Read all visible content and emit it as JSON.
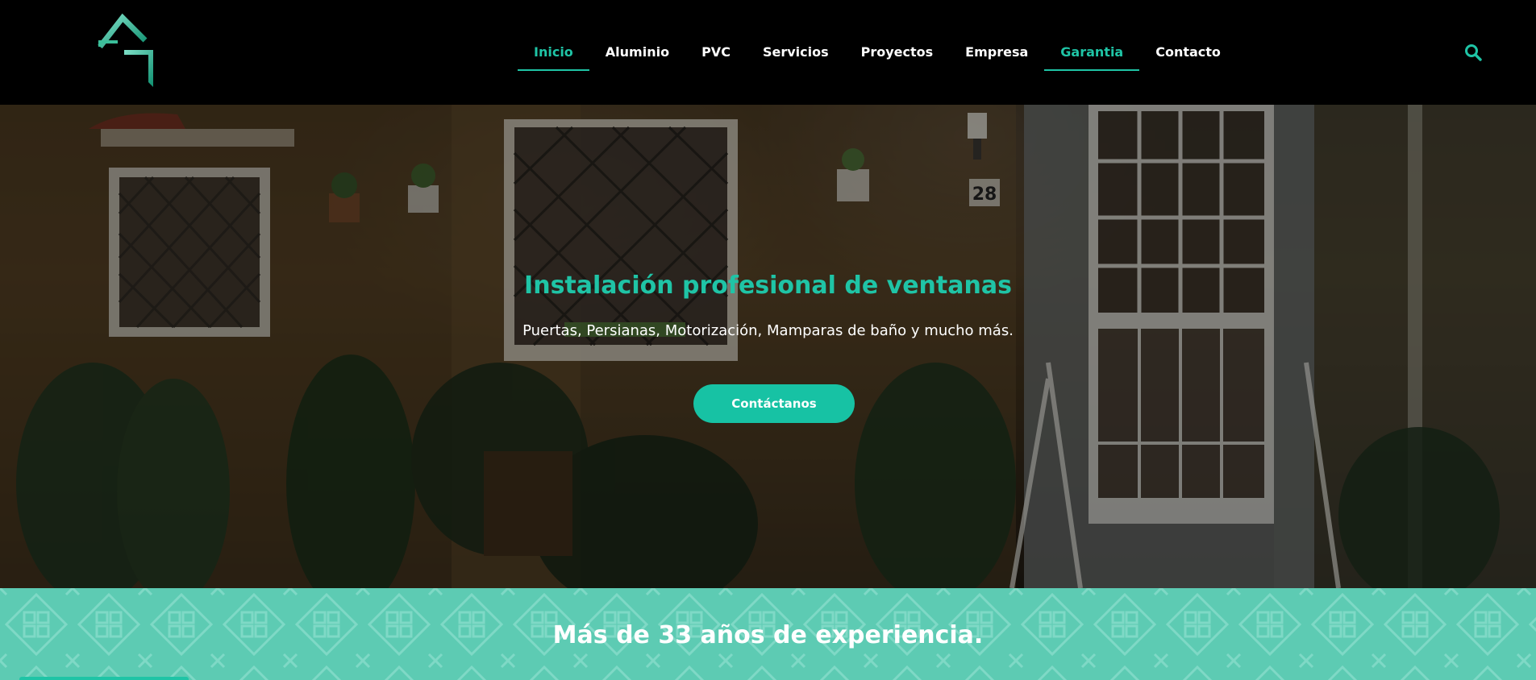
{
  "brand": {
    "logo_name": "house-logo",
    "accent": "#1fc4a6"
  },
  "nav": {
    "items": [
      {
        "label": "Inicio",
        "active": true
      },
      {
        "label": "Aluminio",
        "active": false
      },
      {
        "label": "PVC",
        "active": false
      },
      {
        "label": "Servicios",
        "active": false
      },
      {
        "label": "Proyectos",
        "active": false
      },
      {
        "label": "Empresa",
        "active": false
      },
      {
        "label": "Garantia",
        "active": true
      },
      {
        "label": "Contacto",
        "active": false
      }
    ],
    "search_icon": "search-icon"
  },
  "hero": {
    "title": "Instalación profesional de ventanas",
    "subtitle": "Puertas, Persianas, Motorización, Mamparas de baño y  mucho más.",
    "cta_label": "Contáctanos",
    "house_number": "28"
  },
  "band": {
    "title": "Más de 33 años de experiencia.",
    "color": "#5dcbb3"
  }
}
